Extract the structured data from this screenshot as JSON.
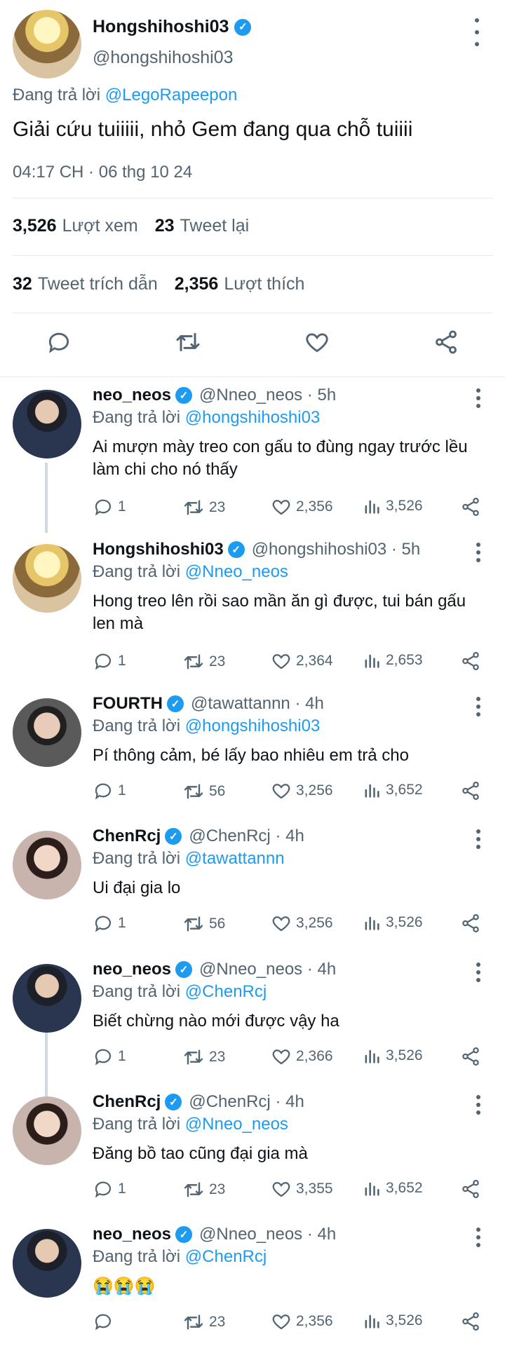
{
  "main_tweet": {
    "avatar": "profile-photo",
    "name": "Hongshihoshi03",
    "verified": true,
    "handle": "@hongshihoshi03",
    "replying_prefix": "Đang trả lời",
    "replying_to": "@LegoRapeepon",
    "text": "Giải cứu tuiiiii, nhỏ Gem đang qua chỗ tuiiii",
    "timestamp": "04:17 CH · 06 thg 10 24",
    "stats": {
      "views_count": "3,526",
      "views_label": "Lượt xem",
      "retweets_count": "23",
      "retweets_label": "Tweet lại",
      "quotes_count": "32",
      "quotes_label": "Tweet trích dẫn",
      "likes_count": "2,356",
      "likes_label": "Lượt thích"
    },
    "actions": [
      "reply-icon",
      "retweet-icon",
      "like-icon",
      "share-icon"
    ]
  },
  "replies": [
    {
      "name": "neo_neos",
      "handle": "@Nneo_neos",
      "time": "· 5h",
      "replying_prefix": "Đang trả lời",
      "replying_to": "@hongshihoshi03",
      "text": "Ai mượn mày treo con gấu to đùng ngay trước lều làm chi cho nó thấy",
      "replies": "1",
      "retweets": "23",
      "likes": "2,356",
      "views": "3,526"
    },
    {
      "name": "Hongshihoshi03",
      "handle": "@hongshihoshi03",
      "time": "· 5h",
      "replying_prefix": "Đang trả lời",
      "replying_to": "@Nneo_neos",
      "text": "Hong treo lên rồi sao mần ăn gì được, tui bán gấu len mà",
      "replies": "1",
      "retweets": "23",
      "likes": "2,364",
      "views": "2,653"
    },
    {
      "name": "FOURTH",
      "handle": "@tawattannn",
      "time": "· 4h",
      "replying_prefix": "Đang trả lời",
      "replying_to": "@hongshihoshi03",
      "text": "Pí thông cảm, bé lấy bao nhiêu em trả cho",
      "replies": "1",
      "retweets": "56",
      "likes": "3,256",
      "views": "3,652"
    },
    {
      "name": "ChenRcj",
      "handle": "@ChenRcj",
      "time": "· 4h",
      "replying_prefix": "Đang trả lời",
      "replying_to": "@tawattannn",
      "text": "Ui đại gia lo",
      "replies": "1",
      "retweets": "56",
      "likes": "3,256",
      "views": "3,526"
    },
    {
      "name": "neo_neos",
      "handle": "@Nneo_neos",
      "time": "· 4h",
      "replying_prefix": "Đang trả lời",
      "replying_to": "@ChenRcj",
      "text": "Biết chừng nào mới được vậy ha",
      "replies": "1",
      "retweets": "23",
      "likes": "2,366",
      "views": "3,526"
    },
    {
      "name": "ChenRcj",
      "handle": "@ChenRcj",
      "time": "· 4h",
      "replying_prefix": "Đang trả lời",
      "replying_to": "@Nneo_neos",
      "text": "Đăng bồ tao cũng đại gia mà",
      "replies": "1",
      "retweets": "23",
      "likes": "3,355",
      "views": "3,652"
    },
    {
      "name": "neo_neos",
      "handle": "@Nneo_neos",
      "time": "· 4h",
      "replying_prefix": "Đang trả lời",
      "replying_to": "@ChenRcj",
      "text": "😭😭😭",
      "replies": "",
      "retweets": "23",
      "likes": "2,356",
      "views": "3,526"
    }
  ],
  "colors": {
    "accent": "#1d9bf0",
    "text": "#0f1419",
    "muted": "#536471",
    "divider": "#e6ebee",
    "thread": "#cfd9de"
  }
}
